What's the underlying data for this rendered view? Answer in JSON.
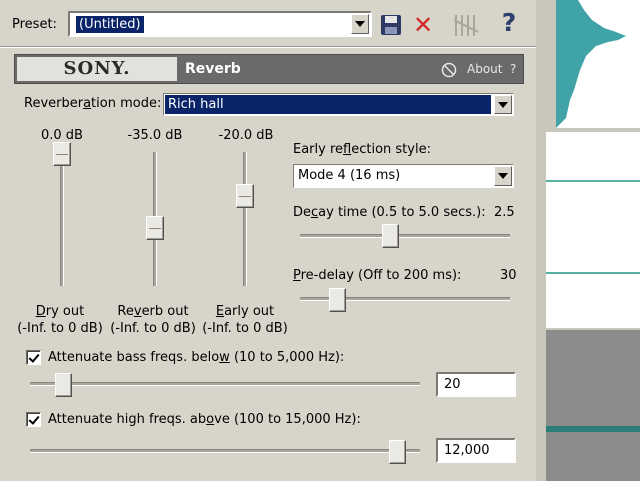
{
  "preset": {
    "label": "Preset:",
    "value": "(Untitled)"
  },
  "toolbar_icons": [
    "save-icon",
    "delete-icon",
    "plugin-chain-icon",
    "help-icon"
  ],
  "header": {
    "brand": "SONY.",
    "plugin_name": "Reverb",
    "about_label": "About",
    "about_help": "?"
  },
  "reverb_mode": {
    "label": "Reverberation mode:",
    "value": "Rich hall"
  },
  "faders": [
    {
      "value_label": "0.0 dB",
      "name": "Dry out",
      "range": "(-Inf. to 0 dB)",
      "level_db": 0.0
    },
    {
      "value_label": "-35.0 dB",
      "name": "Reverb out",
      "range": "(-Inf. to 0 dB)",
      "level_db": -35.0
    },
    {
      "value_label": "-20.0 dB",
      "name": "Early out",
      "range": "(-Inf. to 0 dB)",
      "level_db": -20.0
    }
  ],
  "early_reflection": {
    "label": "Early reflection style:",
    "value": "Mode 4  (16 ms)"
  },
  "decay": {
    "label": "Decay time (0.5 to 5.0 secs.):",
    "value": "2.5",
    "min": 0.5,
    "max": 5.0,
    "current": 2.5
  },
  "predelay": {
    "label": "Pre-delay (Off to 200 ms):",
    "value": "30",
    "min": 0,
    "max": 200,
    "current": 30
  },
  "bass_attenuate": {
    "label": "Attenuate bass freqs. below (10 to 5,000 Hz):",
    "checked": true,
    "value": "20",
    "position_fraction": 0.04
  },
  "high_attenuate": {
    "label": "Attenuate high freqs. above (100 to 15,000 Hz):",
    "checked": true,
    "value": "12,000",
    "position_fraction": 0.99
  },
  "colors": {
    "selection": "#0a246a",
    "delete_red": "#d42828",
    "waveform": "#3fa3a8",
    "track_line": "#58b2a3"
  }
}
